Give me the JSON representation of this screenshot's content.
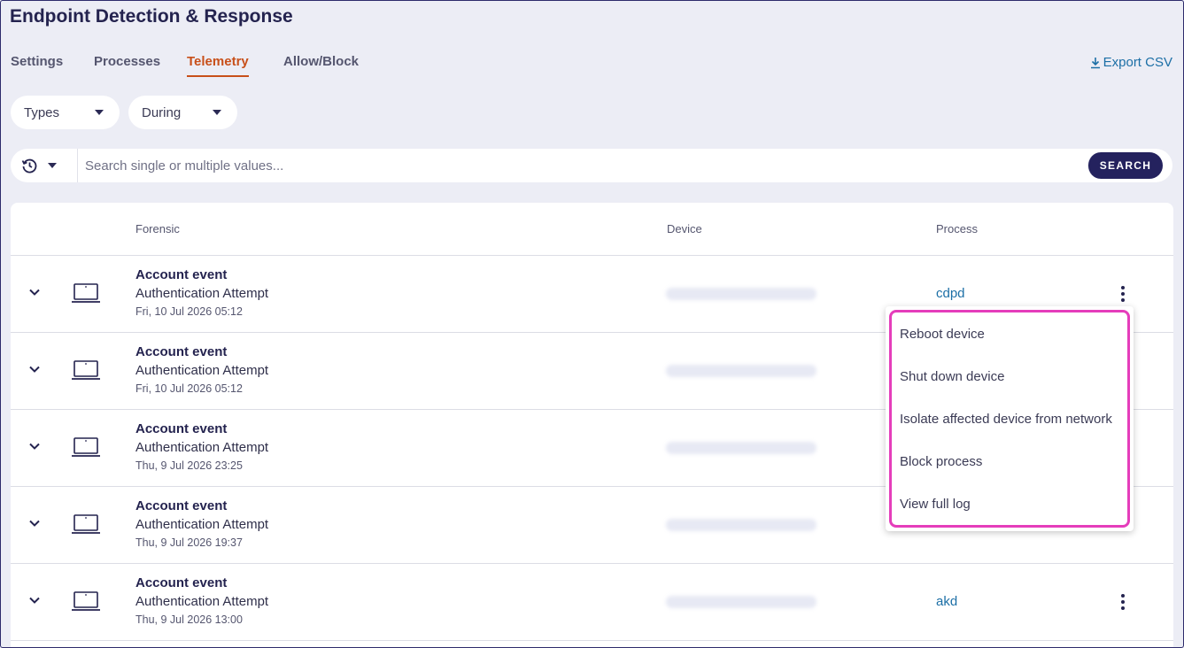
{
  "app": {
    "title": "Endpoint Detection & Response"
  },
  "tabs": [
    {
      "label": "Settings"
    },
    {
      "label": "Processes"
    },
    {
      "label": "Telemetry",
      "active": true
    },
    {
      "label": "Allow/Block"
    }
  ],
  "export": {
    "label": "Export CSV",
    "icon": "download-icon"
  },
  "filters": [
    {
      "label": "Types",
      "icon": "caret-down-icon"
    },
    {
      "label": "During",
      "icon": "caret-down-icon"
    }
  ],
  "search": {
    "history_icon": "history-icon",
    "placeholder": "Search single or multiple values...",
    "value": "",
    "button_label": "SEARCH"
  },
  "table": {
    "columns": {
      "forensic": "Forensic",
      "device": "Device",
      "process": "Process"
    },
    "rows": [
      {
        "title": "Account event",
        "subtitle": "Authentication Attempt",
        "time": "Fri, 10 Jul 2026 05:12",
        "process": "cdpd",
        "icon": "laptop-icon"
      },
      {
        "title": "Account event",
        "subtitle": "Authentication Attempt",
        "time": "Fri, 10 Jul 2026 05:12",
        "process": "",
        "icon": "laptop-icon"
      },
      {
        "title": "Account event",
        "subtitle": "Authentication Attempt",
        "time": "Thu, 9 Jul 2026 23:25",
        "process": "",
        "icon": "laptop-icon"
      },
      {
        "title": "Account event",
        "subtitle": "Authentication Attempt",
        "time": "Thu, 9 Jul 2026 19:37",
        "process": "",
        "icon": "laptop-icon"
      },
      {
        "title": "Account event",
        "subtitle": "Authentication Attempt",
        "time": "Thu, 9 Jul 2026 13:00",
        "process": "akd",
        "icon": "laptop-icon"
      }
    ]
  },
  "context_menu": {
    "items": [
      {
        "label": "Reboot device"
      },
      {
        "label": "Shut down device"
      },
      {
        "label": "Isolate affected device from network"
      },
      {
        "label": "Block process"
      },
      {
        "label": "View full log"
      }
    ]
  },
  "colors": {
    "accent": "#c8501a",
    "link": "#1c6fa6",
    "primary_dark": "#24225e",
    "highlight": "#e53dbb",
    "background": "#ecedf5"
  }
}
